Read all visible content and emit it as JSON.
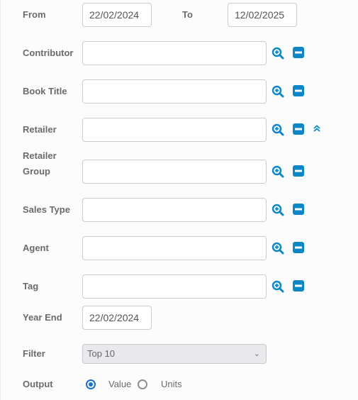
{
  "form": {
    "from": {
      "label": "From",
      "value": "22/02/2024"
    },
    "to": {
      "label": "To",
      "value": "12/02/2025"
    },
    "fields": [
      {
        "label": "Contributor",
        "value": ""
      },
      {
        "label": "Book Title",
        "value": ""
      },
      {
        "label": "Retailer",
        "value": ""
      },
      {
        "label_line1": "Retailer",
        "label_line2": "Group",
        "value": ""
      },
      {
        "label": "Sales Type",
        "value": ""
      },
      {
        "label": "Agent",
        "value": ""
      },
      {
        "label": "Tag",
        "value": ""
      }
    ],
    "year_end": {
      "label": "Year End",
      "value": "22/02/2024"
    },
    "filter": {
      "label": "Filter",
      "selected": "Top 10"
    },
    "output": {
      "label": "Output",
      "options": [
        {
          "label": "Value",
          "checked": true
        },
        {
          "label": "Units",
          "checked": false
        }
      ]
    }
  },
  "icons": {
    "search": "zoom-in-icon",
    "remove": "minus-square-icon",
    "collapse": "double-chevron-up-icon"
  },
  "colors": {
    "accent": "#0b87c9",
    "radio": "#1a6fd8"
  }
}
